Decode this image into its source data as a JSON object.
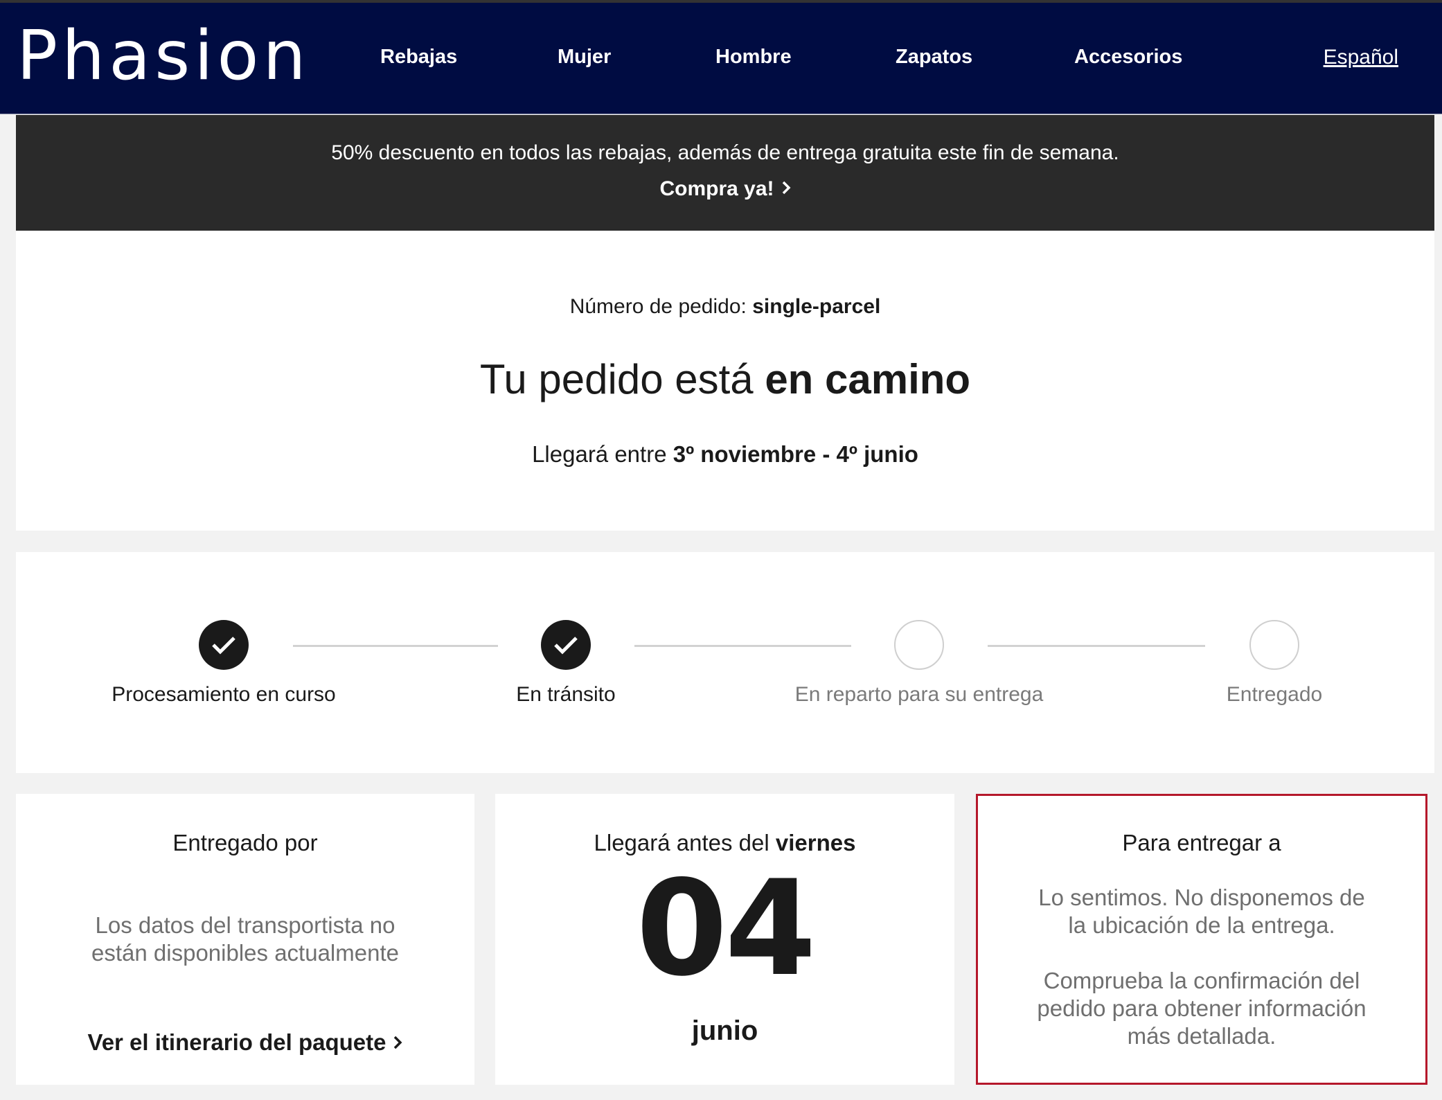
{
  "header": {
    "logo": "Phasion",
    "nav": [
      "Rebajas",
      "Mujer",
      "Hombre",
      "Zapatos",
      "Accesorios"
    ],
    "language": "Español",
    "colors": {
      "nav_bg": "#000c42",
      "promo_bg": "#2a2a2a",
      "highlight_border": "#b5182b"
    }
  },
  "promo": {
    "text": "50% descuento en todos las rebajas, además de entrega gratuita este fin de semana.",
    "cta": "Compra ya!",
    "cta_icon": "chevron-right-icon"
  },
  "summary": {
    "order_label": "Número de pedido:",
    "order_number": "single-parcel",
    "headline_prefix": "Tu pedido está",
    "headline_emphasis": "en camino",
    "eta_prefix": "Llegará entre",
    "eta_range": "3º noviembre - 4º junio"
  },
  "progress": {
    "steps": [
      {
        "label": "Procesamiento en curso",
        "status": "done",
        "icon": "check-icon"
      },
      {
        "label": "En tránsito",
        "status": "done",
        "icon": "check-icon"
      },
      {
        "label": "En reparto para su entrega",
        "status": "pending",
        "icon": "empty-circle-icon"
      },
      {
        "label": "Entregado",
        "status": "pending",
        "icon": "empty-circle-icon"
      }
    ]
  },
  "carrier": {
    "title": "Entregado por",
    "message_line1": "Los datos del transportista no",
    "message_line2": "están disponibles actualmente",
    "link": "Ver el itinerario del paquete",
    "link_icon": "chevron-right-icon"
  },
  "arrival": {
    "title_prefix": "Llegará antes del",
    "weekday": "viernes",
    "day": "04",
    "month": "junio"
  },
  "deliver_to": {
    "title": "Para entregar a",
    "message_line1": "Lo sentimos. No disponemos de",
    "message_line2": "la ubicación de la entrega.",
    "note_line1": "Comprueba la confirmación del",
    "note_line2": "pedido para obtener información",
    "note_line3": "más detallada."
  }
}
